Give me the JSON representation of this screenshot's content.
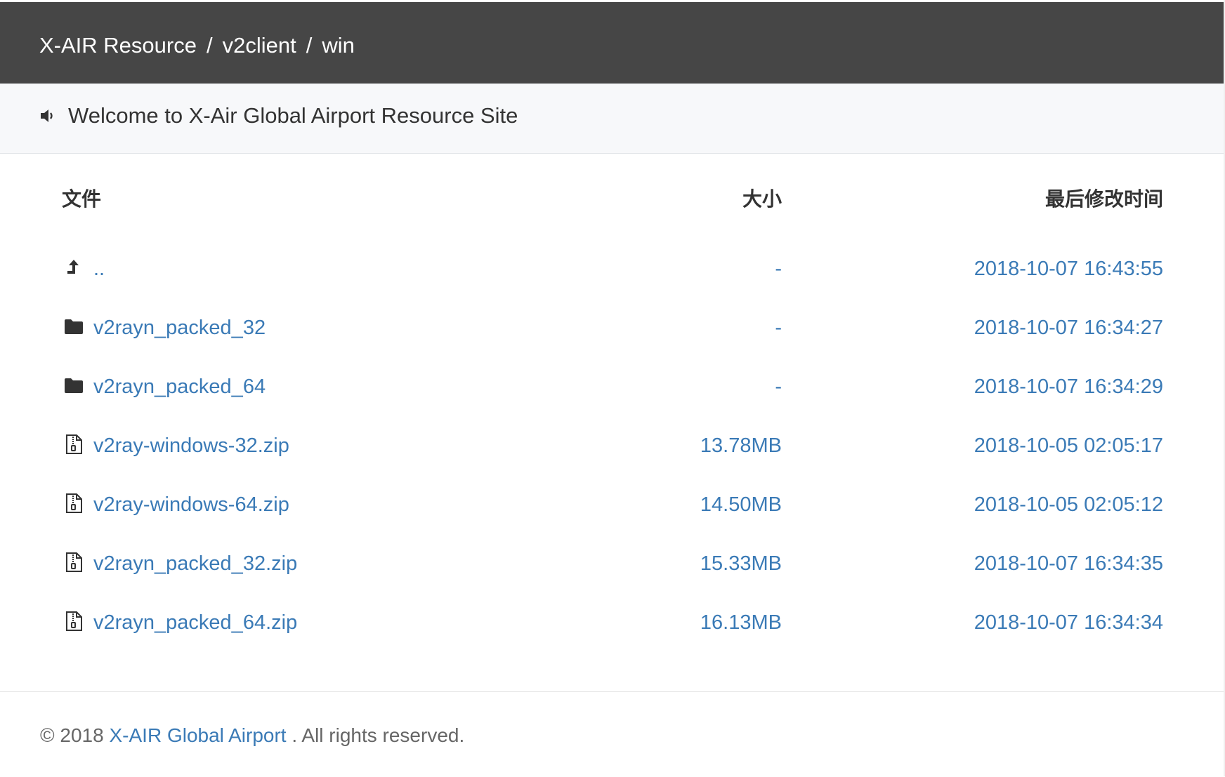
{
  "header": {
    "breadcrumb": [
      {
        "label": "X-AIR Resource"
      },
      {
        "label": "v2client"
      },
      {
        "label": "win"
      }
    ],
    "separator": "/",
    "background_color": "#464646"
  },
  "notice": {
    "icon": "speaker-icon",
    "text": "Welcome to X-Air Global Airport Resource Site"
  },
  "table": {
    "columns": {
      "name": "文件",
      "size": "大小",
      "modified": "最后修改时间"
    },
    "rows": [
      {
        "icon": "parent-dir-icon",
        "name": "..",
        "size": "-",
        "modified": "2018-10-07 16:43:55"
      },
      {
        "icon": "folder-icon",
        "name": "v2rayn_packed_32",
        "size": "-",
        "modified": "2018-10-07 16:34:27"
      },
      {
        "icon": "folder-icon",
        "name": "v2rayn_packed_64",
        "size": "-",
        "modified": "2018-10-07 16:34:29"
      },
      {
        "icon": "zip-file-icon",
        "name": "v2ray-windows-32.zip",
        "size": "13.78MB",
        "modified": "2018-10-05 02:05:17"
      },
      {
        "icon": "zip-file-icon",
        "name": "v2ray-windows-64.zip",
        "size": "14.50MB",
        "modified": "2018-10-05 02:05:12"
      },
      {
        "icon": "zip-file-icon",
        "name": "v2rayn_packed_32.zip",
        "size": "15.33MB",
        "modified": "2018-10-07 16:34:35"
      },
      {
        "icon": "zip-file-icon",
        "name": "v2rayn_packed_64.zip",
        "size": "16.13MB",
        "modified": "2018-10-07 16:34:34"
      }
    ],
    "link_color": "#3a7ab6"
  },
  "footer": {
    "prefix": "© 2018",
    "brand": "X-AIR Global Airport",
    "suffix": ". All rights reserved."
  }
}
